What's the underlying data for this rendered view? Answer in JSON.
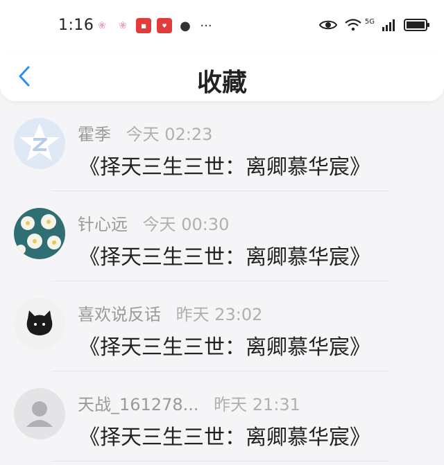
{
  "status_bar": {
    "time": "1:16",
    "network": "5G",
    "notification_icons": [
      "flower-icon",
      "flower-icon",
      "app-badge-icon",
      "app-badge-icon",
      "chat-bubble-icon",
      "more-dots-icon"
    ],
    "right_icons": [
      "eye-icon",
      "wifi-icon",
      "signal-icon",
      "battery-icon"
    ]
  },
  "header": {
    "back_icon": "chevron-left-icon",
    "title": "收藏",
    "accent_color": "#2a8ff0"
  },
  "items": [
    {
      "name": "霍季",
      "time": "今天 02:23",
      "content": "《择天三生三世：离卿慕华宸》",
      "avatar": "default-z-avatar"
    },
    {
      "name": "针心远",
      "time": "今天 00:30",
      "content": "《择天三生三世：离卿慕华宸》",
      "avatar": "flowers-avatar"
    },
    {
      "name": "喜欢说反话",
      "time": "昨天 23:02",
      "content": "《择天三生三世：离卿慕华宸》",
      "avatar": "black-cat-avatar"
    },
    {
      "name": "天战_161278...",
      "time": "昨天 21:31",
      "content": "《择天三生三世：离卿慕华宸》",
      "avatar": "default-person-avatar"
    }
  ]
}
